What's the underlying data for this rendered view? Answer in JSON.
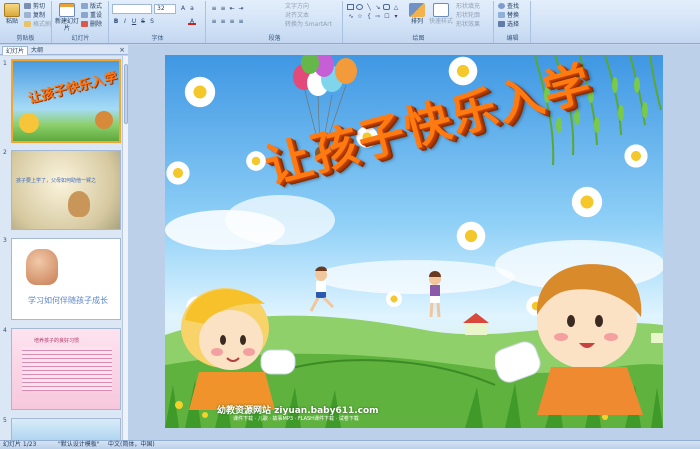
{
  "ribbon": {
    "clipboard": {
      "title": "剪贴板",
      "paste": "粘贴",
      "cut": "剪切",
      "copy": "复制",
      "format_painter": "格式刷"
    },
    "slides": {
      "title": "幻灯片",
      "new_slide": "新建幻灯片",
      "layout": "版式",
      "reset": "重设",
      "delete": "删除"
    },
    "font": {
      "title": "字体",
      "font_name": "",
      "font_size": "32"
    },
    "paragraph": {
      "title": "段落",
      "text_direction": "文字方向",
      "align_text": "对齐文本",
      "smartart": "转换为 SmartArt"
    },
    "drawing": {
      "title": "绘图",
      "arrange": "排列",
      "quick_styles": "快速样式",
      "shape_fill": "形状填充",
      "shape_outline": "形状轮廓",
      "shape_effects": "形状效果"
    },
    "editing": {
      "title": "编辑",
      "find": "查找",
      "replace": "替换",
      "select": "选择"
    }
  },
  "pane": {
    "tab_slides": "幻灯片",
    "tab_outline": "大纲",
    "close": "×"
  },
  "thumbnails": [
    {
      "number": "1",
      "title": "让孩子快乐入学"
    },
    {
      "number": "2",
      "title": "孩子要上学了，父母如何助他一臂之力呢？"
    },
    {
      "number": "3",
      "title": "学习如何伴随孩子成长"
    },
    {
      "number": "4",
      "title": "培养孩子的良好习惯"
    },
    {
      "number": "5",
      "title": ""
    }
  ],
  "slide": {
    "title": "让孩子快乐入学",
    "footer_site": "幼教资源网站 ziyuan.baby611.com",
    "footer_sub": "课件下载 · 儿歌 · 故事MP3 · FLASH课件下载 · 试卷下载"
  },
  "status": {
    "slide_count": "幻灯片 1/23",
    "theme": "\"默认设计模板\"",
    "language": "中文(简体，中国)"
  },
  "colors": {
    "ribbon": "#d1e2f6",
    "selection": "#f0a830",
    "title": "#ff7a10"
  }
}
